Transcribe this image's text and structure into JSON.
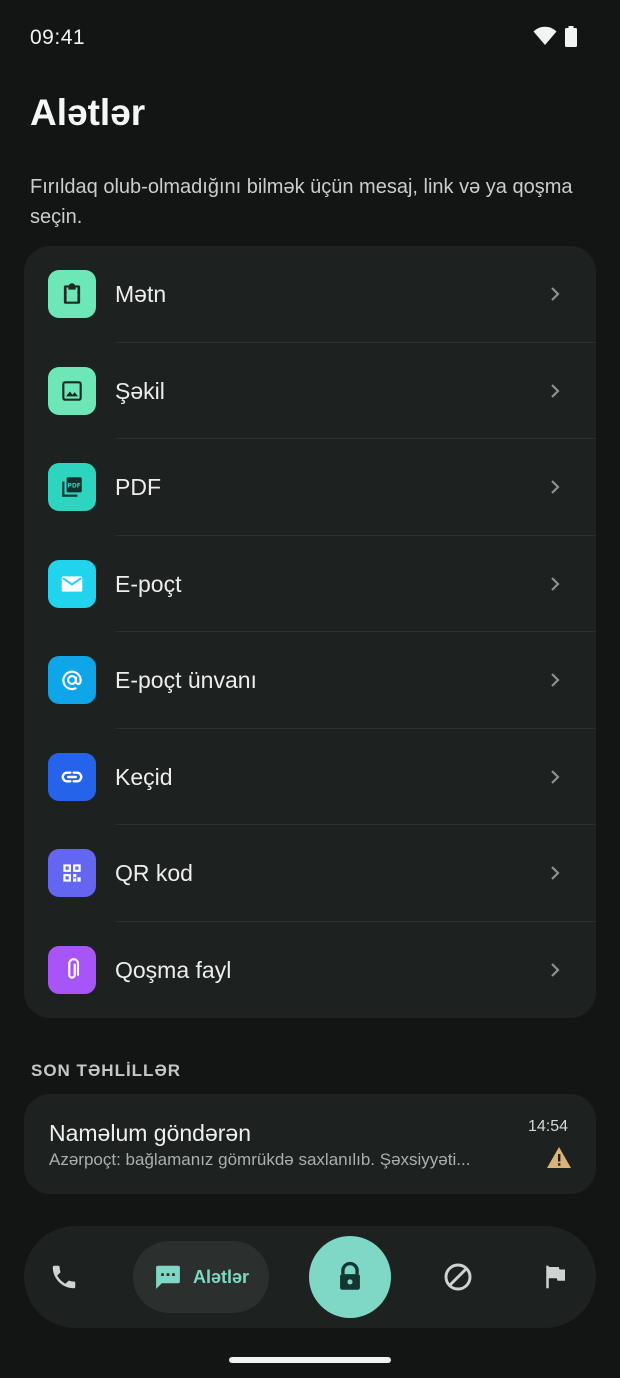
{
  "status_bar": {
    "time": "09:41"
  },
  "page": {
    "title": "Alətlər",
    "subtitle": "Fırıldaq olub-olmadığını bilmək üçün mesaj, link və ya qoşma seçin."
  },
  "tools": [
    {
      "label": "Mətn",
      "icon": "clipboard-icon",
      "color": "#6ee7b7"
    },
    {
      "label": "Şəkil",
      "icon": "image-icon",
      "color": "#6ee7b7"
    },
    {
      "label": "PDF",
      "icon": "pdf-icon",
      "color": "#2dd4bf"
    },
    {
      "label": "E-poçt",
      "icon": "mail-icon",
      "color": "#22d3ee"
    },
    {
      "label": "E-poçt ünvanı",
      "icon": "at-sign-icon",
      "color": "#0ea5e9"
    },
    {
      "label": "Keçid",
      "icon": "link-icon",
      "color": "#2563eb"
    },
    {
      "label": "QR kod",
      "icon": "qr-code-icon",
      "color": "#6366f1"
    },
    {
      "label": "Qoşma fayl",
      "icon": "paperclip-icon",
      "color": "#a855f7"
    }
  ],
  "recent": {
    "section_title": "SON TƏHLİLLƏR",
    "items": [
      {
        "sender": "Naməlum göndərən",
        "preview": "Azərpoçt: bağlamanız gömrükdə saxlanılıb. Şəxsiyyəti...",
        "time": "14:54",
        "status_icon": "warning-icon",
        "status_color": "#d8b476"
      }
    ]
  },
  "bottom_nav": {
    "items": [
      {
        "name": "calls",
        "icon": "phone-icon"
      },
      {
        "name": "tools",
        "icon": "message-icon",
        "label": "Alətlər",
        "active": true
      },
      {
        "name": "protect",
        "icon": "lock-icon"
      },
      {
        "name": "blocked",
        "icon": "block-icon"
      },
      {
        "name": "reports",
        "icon": "flag-icon"
      }
    ],
    "accent": "#7fd8c6"
  }
}
